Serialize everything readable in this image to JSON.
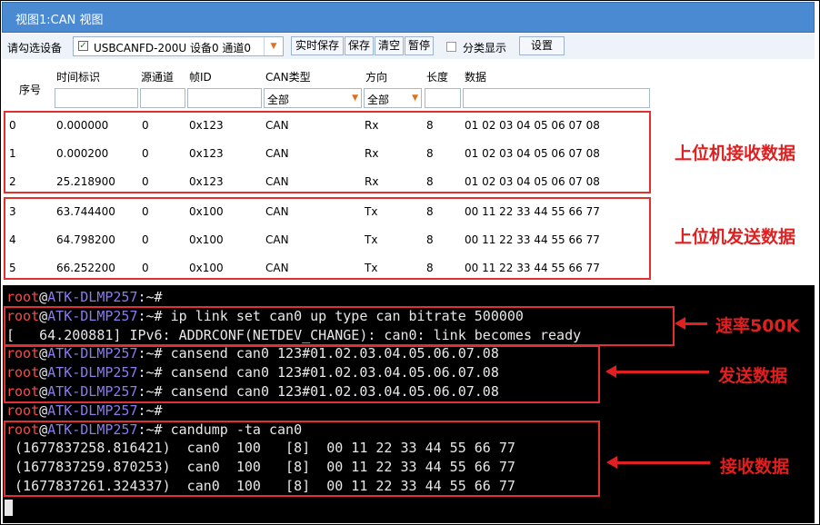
{
  "window": {
    "title": "视图1:CAN 视图"
  },
  "toolbar": {
    "device_label": "请勾选设备",
    "device_value": "USBCANFD-200U 设备0 通道0",
    "buttons": [
      "实时保存",
      "保存",
      "清空",
      "暂停"
    ],
    "classify_label": "分类显示",
    "settings_label": "设置"
  },
  "columns": {
    "seq": "序号",
    "time": "时间标识",
    "src": "源通道",
    "id": "帧ID",
    "type": "CAN类型",
    "dir": "方向",
    "len": "长度",
    "data": "数据",
    "type_filter": "全部",
    "dir_filter": "全部"
  },
  "rows": [
    {
      "seq": "0",
      "time": "0.000000",
      "src": "0",
      "id": "0x123",
      "type": "CAN",
      "dir": "Rx",
      "len": "8",
      "data": "01 02 03 04 05 06 07 08"
    },
    {
      "seq": "1",
      "time": "0.000200",
      "src": "0",
      "id": "0x123",
      "type": "CAN",
      "dir": "Rx",
      "len": "8",
      "data": "01 02 03 04 05 06 07 08"
    },
    {
      "seq": "2",
      "time": "25.218900",
      "src": "0",
      "id": "0x123",
      "type": "CAN",
      "dir": "Rx",
      "len": "8",
      "data": "01 02 03 04 05 06 07 08"
    },
    {
      "seq": "3",
      "time": "63.744400",
      "src": "0",
      "id": "0x100",
      "type": "CAN",
      "dir": "Tx",
      "len": "8",
      "data": "00 11 22 33 44 55 66 77"
    },
    {
      "seq": "4",
      "time": "64.798200",
      "src": "0",
      "id": "0x100",
      "type": "CAN",
      "dir": "Tx",
      "len": "8",
      "data": "00 11 22 33 44 55 66 77"
    },
    {
      "seq": "5",
      "time": "66.252200",
      "src": "0",
      "id": "0x100",
      "type": "CAN",
      "dir": "Tx",
      "len": "8",
      "data": "00 11 22 33 44 55 66 77"
    }
  ],
  "annotations": {
    "rx": "上位机接收数据",
    "tx": "上位机发送数据",
    "bitrate": "速率500K",
    "send": "发送数据",
    "recv": "接收数据"
  },
  "terminal": {
    "user": "root",
    "at": "@",
    "host": "ATK-DLMP257",
    "prompt_tail": ":~# ",
    "lines": [
      {
        "cmd": ""
      },
      {
        "cmd": "ip link set can0 up type can bitrate 500000"
      },
      {
        "plain": "[   64.200881] IPv6: ADDRCONF(NETDEV_CHANGE): can0: link becomes ready"
      },
      {
        "cmd": "cansend can0 123#01.02.03.04.05.06.07.08"
      },
      {
        "cmd": "cansend can0 123#01.02.03.04.05.06.07.08"
      },
      {
        "cmd": "cansend can0 123#01.02.03.04.05.06.07.08"
      },
      {
        "cmd": ""
      },
      {
        "cmd": "candump -ta can0"
      },
      {
        "plain": " (1677837258.816421)  can0  100   [8]  00 11 22 33 44 55 66 77"
      },
      {
        "plain": " (1677837259.870253)  can0  100   [8]  00 11 22 33 44 55 66 77"
      },
      {
        "plain": " (1677837261.324337)  can0  100   [8]  00 11 22 33 44 55 66 77"
      }
    ]
  },
  "colors": {
    "title_bar": "#4a8ad2",
    "annotation_red": "#e02020",
    "prompt_user": "#f24b4b",
    "prompt_host": "#8a7bf0"
  }
}
